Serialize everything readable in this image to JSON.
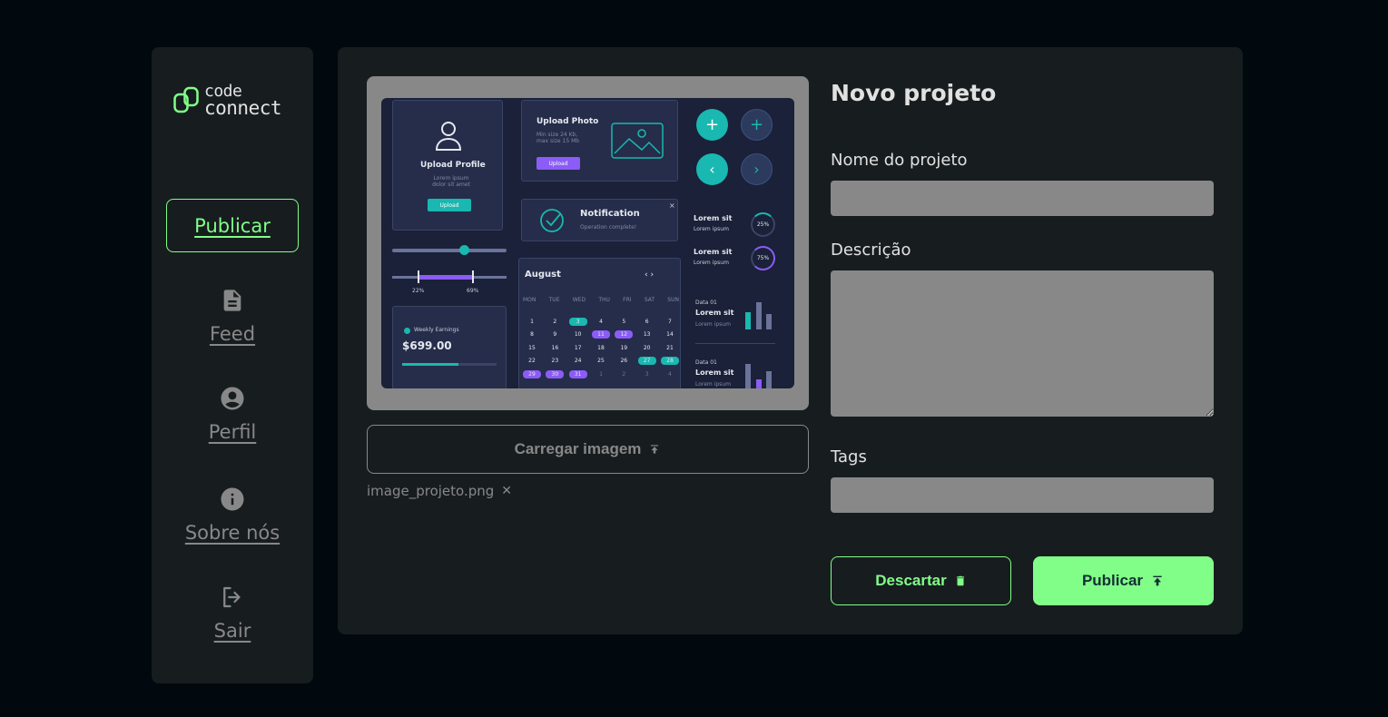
{
  "sidebar": {
    "logo": {
      "line1": "code",
      "line2": "connect"
    },
    "publish_label": "Publicar",
    "items": [
      {
        "label": "Feed",
        "icon": "document-icon"
      },
      {
        "label": "Perfil",
        "icon": "account-circle-icon"
      },
      {
        "label": "Sobre nós",
        "icon": "info-icon"
      },
      {
        "label": "Sair",
        "icon": "logout-icon"
      }
    ]
  },
  "form": {
    "title": "Novo projeto",
    "name_label": "Nome do projeto",
    "description_label": "Descrição",
    "tags_label": "Tags",
    "upload_label": "Carregar imagem",
    "file_name": "image_projeto.png",
    "discard_label": "Descartar",
    "publish_label": "Publicar"
  },
  "preview": {
    "upload_profile": "Upload Profile",
    "upload_profile_sub": "Lorem ipsum dolor sit amet",
    "upload_btn": "Upload",
    "upload_photo": "Upload Photo",
    "upload_photo_sub": "Min size 24 Kb, max size 15 Mb",
    "notification": "Notification",
    "notification_sub": "Operation complete!",
    "slider_left": "22%",
    "slider_right": "69%",
    "earnings_label": "Weekly Earnings",
    "earnings_value": "$699.00",
    "month": "August",
    "weekdays": [
      "MON",
      "TUE",
      "WED",
      "THU",
      "FRI",
      "SAT",
      "SUN"
    ],
    "lorem1": "Lorem sit",
    "lorem2": "Lorem ipsum",
    "pct1": "25%",
    "pct2": "75%",
    "data_label": "Data 01"
  },
  "colors": {
    "accent": "#81fe88",
    "panel": "#171d1f",
    "background": "#01080e",
    "muted": "#888888"
  }
}
